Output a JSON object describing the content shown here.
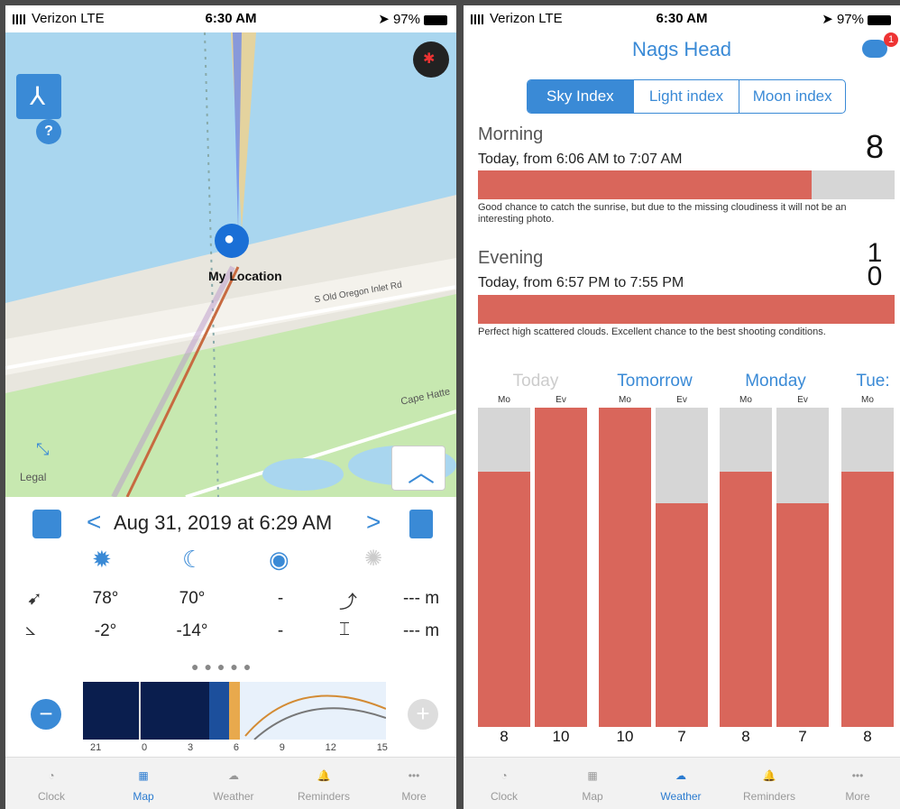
{
  "left_phone": {
    "status": {
      "carrier": "Verizon  LTE",
      "time": "6:30 AM",
      "battery": "97%"
    },
    "map": {
      "my_location_label": "My Location",
      "road1": "S Old Oregon Inlet Rd",
      "road2": "Cape Hatte",
      "legal": "Legal",
      "help": "?"
    },
    "date_nav": {
      "date": "Aug 31, 2019 at 6:29 AM",
      "prev": "<",
      "next": ">"
    },
    "values": {
      "sun_azimuth": "78°",
      "moon_azimuth": "70°",
      "poi_azimuth": "-",
      "distance1": "--- m",
      "sun_elevation": "-2°",
      "moon_elevation": "-14°",
      "poi_elevation": "-",
      "distance2": "--- m"
    },
    "timeline_ticks": [
      "21",
      "0",
      "3",
      "6",
      "9",
      "12",
      "15"
    ],
    "tabs": [
      "Clock",
      "Map",
      "Weather",
      "Reminders",
      "More"
    ],
    "active_tab": "Map"
  },
  "right_phone": {
    "status": {
      "carrier": "Verizon  LTE",
      "time": "6:30 AM",
      "battery": "97%"
    },
    "title": "Nags Head",
    "notification_badge": "1",
    "segments": [
      "Sky Index",
      "Light index",
      "Moon index"
    ],
    "selected_segment": "Sky Index",
    "morning": {
      "heading": "Morning",
      "range": "Today, from 6:06 AM to 7:07 AM",
      "score": "8",
      "level": 0.8,
      "note": "Good chance to catch the sunrise, but due to the missing cloudiness it will not be an interesting photo."
    },
    "evening": {
      "heading": "Evening",
      "range": "Today, from 6:57 PM to 7:55 PM",
      "score": "10",
      "level": 1.0,
      "note": "Perfect high scattered clouds. Excellent chance to the best shooting conditions."
    },
    "days": [
      "Today",
      "Tomorrow",
      "Monday",
      "Tue:"
    ],
    "col_labels": {
      "mo": "Mo",
      "ev": "Ev"
    },
    "forecast": [
      8,
      10,
      10,
      7,
      8,
      7,
      8
    ],
    "tabs": [
      "Clock",
      "Map",
      "Weather",
      "Reminders",
      "More"
    ],
    "active_tab": "Weather"
  },
  "colors": {
    "accent": "#3a8ad6",
    "score_bar": "#d9665b",
    "empty_bar": "#d6d6d6"
  }
}
